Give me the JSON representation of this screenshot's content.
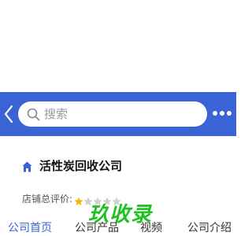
{
  "header": {
    "search_placeholder": "搜索",
    "accent_color": "#3a63d6"
  },
  "shop": {
    "name": "活性炭回收公司",
    "rating_label": "店铺总评价:",
    "rating": 1,
    "rating_max": 5
  },
  "watermark": {
    "text": "玖收录",
    "color": "#1ec21e"
  },
  "tabs": [
    {
      "label": "公司首页",
      "active": true
    },
    {
      "label": "公司产品",
      "active": false
    },
    {
      "label": "视频",
      "active": false
    },
    {
      "label": "公司介绍",
      "active": false
    }
  ]
}
